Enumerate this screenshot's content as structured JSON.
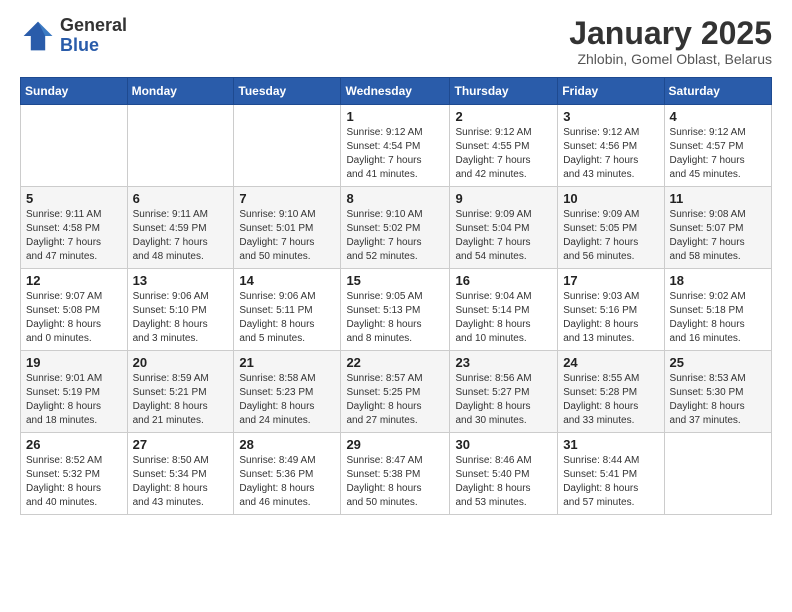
{
  "header": {
    "logo_general": "General",
    "logo_blue": "Blue",
    "month_title": "January 2025",
    "location": "Zhlobin, Gomel Oblast, Belarus"
  },
  "weekdays": [
    "Sunday",
    "Monday",
    "Tuesday",
    "Wednesday",
    "Thursday",
    "Friday",
    "Saturday"
  ],
  "weeks": [
    [
      {
        "day": "",
        "info": ""
      },
      {
        "day": "",
        "info": ""
      },
      {
        "day": "",
        "info": ""
      },
      {
        "day": "1",
        "info": "Sunrise: 9:12 AM\nSunset: 4:54 PM\nDaylight: 7 hours\nand 41 minutes."
      },
      {
        "day": "2",
        "info": "Sunrise: 9:12 AM\nSunset: 4:55 PM\nDaylight: 7 hours\nand 42 minutes."
      },
      {
        "day": "3",
        "info": "Sunrise: 9:12 AM\nSunset: 4:56 PM\nDaylight: 7 hours\nand 43 minutes."
      },
      {
        "day": "4",
        "info": "Sunrise: 9:12 AM\nSunset: 4:57 PM\nDaylight: 7 hours\nand 45 minutes."
      }
    ],
    [
      {
        "day": "5",
        "info": "Sunrise: 9:11 AM\nSunset: 4:58 PM\nDaylight: 7 hours\nand 47 minutes."
      },
      {
        "day": "6",
        "info": "Sunrise: 9:11 AM\nSunset: 4:59 PM\nDaylight: 7 hours\nand 48 minutes."
      },
      {
        "day": "7",
        "info": "Sunrise: 9:10 AM\nSunset: 5:01 PM\nDaylight: 7 hours\nand 50 minutes."
      },
      {
        "day": "8",
        "info": "Sunrise: 9:10 AM\nSunset: 5:02 PM\nDaylight: 7 hours\nand 52 minutes."
      },
      {
        "day": "9",
        "info": "Sunrise: 9:09 AM\nSunset: 5:04 PM\nDaylight: 7 hours\nand 54 minutes."
      },
      {
        "day": "10",
        "info": "Sunrise: 9:09 AM\nSunset: 5:05 PM\nDaylight: 7 hours\nand 56 minutes."
      },
      {
        "day": "11",
        "info": "Sunrise: 9:08 AM\nSunset: 5:07 PM\nDaylight: 7 hours\nand 58 minutes."
      }
    ],
    [
      {
        "day": "12",
        "info": "Sunrise: 9:07 AM\nSunset: 5:08 PM\nDaylight: 8 hours\nand 0 minutes."
      },
      {
        "day": "13",
        "info": "Sunrise: 9:06 AM\nSunset: 5:10 PM\nDaylight: 8 hours\nand 3 minutes."
      },
      {
        "day": "14",
        "info": "Sunrise: 9:06 AM\nSunset: 5:11 PM\nDaylight: 8 hours\nand 5 minutes."
      },
      {
        "day": "15",
        "info": "Sunrise: 9:05 AM\nSunset: 5:13 PM\nDaylight: 8 hours\nand 8 minutes."
      },
      {
        "day": "16",
        "info": "Sunrise: 9:04 AM\nSunset: 5:14 PM\nDaylight: 8 hours\nand 10 minutes."
      },
      {
        "day": "17",
        "info": "Sunrise: 9:03 AM\nSunset: 5:16 PM\nDaylight: 8 hours\nand 13 minutes."
      },
      {
        "day": "18",
        "info": "Sunrise: 9:02 AM\nSunset: 5:18 PM\nDaylight: 8 hours\nand 16 minutes."
      }
    ],
    [
      {
        "day": "19",
        "info": "Sunrise: 9:01 AM\nSunset: 5:19 PM\nDaylight: 8 hours\nand 18 minutes."
      },
      {
        "day": "20",
        "info": "Sunrise: 8:59 AM\nSunset: 5:21 PM\nDaylight: 8 hours\nand 21 minutes."
      },
      {
        "day": "21",
        "info": "Sunrise: 8:58 AM\nSunset: 5:23 PM\nDaylight: 8 hours\nand 24 minutes."
      },
      {
        "day": "22",
        "info": "Sunrise: 8:57 AM\nSunset: 5:25 PM\nDaylight: 8 hours\nand 27 minutes."
      },
      {
        "day": "23",
        "info": "Sunrise: 8:56 AM\nSunset: 5:27 PM\nDaylight: 8 hours\nand 30 minutes."
      },
      {
        "day": "24",
        "info": "Sunrise: 8:55 AM\nSunset: 5:28 PM\nDaylight: 8 hours\nand 33 minutes."
      },
      {
        "day": "25",
        "info": "Sunrise: 8:53 AM\nSunset: 5:30 PM\nDaylight: 8 hours\nand 37 minutes."
      }
    ],
    [
      {
        "day": "26",
        "info": "Sunrise: 8:52 AM\nSunset: 5:32 PM\nDaylight: 8 hours\nand 40 minutes."
      },
      {
        "day": "27",
        "info": "Sunrise: 8:50 AM\nSunset: 5:34 PM\nDaylight: 8 hours\nand 43 minutes."
      },
      {
        "day": "28",
        "info": "Sunrise: 8:49 AM\nSunset: 5:36 PM\nDaylight: 8 hours\nand 46 minutes."
      },
      {
        "day": "29",
        "info": "Sunrise: 8:47 AM\nSunset: 5:38 PM\nDaylight: 8 hours\nand 50 minutes."
      },
      {
        "day": "30",
        "info": "Sunrise: 8:46 AM\nSunset: 5:40 PM\nDaylight: 8 hours\nand 53 minutes."
      },
      {
        "day": "31",
        "info": "Sunrise: 8:44 AM\nSunset: 5:41 PM\nDaylight: 8 hours\nand 57 minutes."
      },
      {
        "day": "",
        "info": ""
      }
    ]
  ]
}
